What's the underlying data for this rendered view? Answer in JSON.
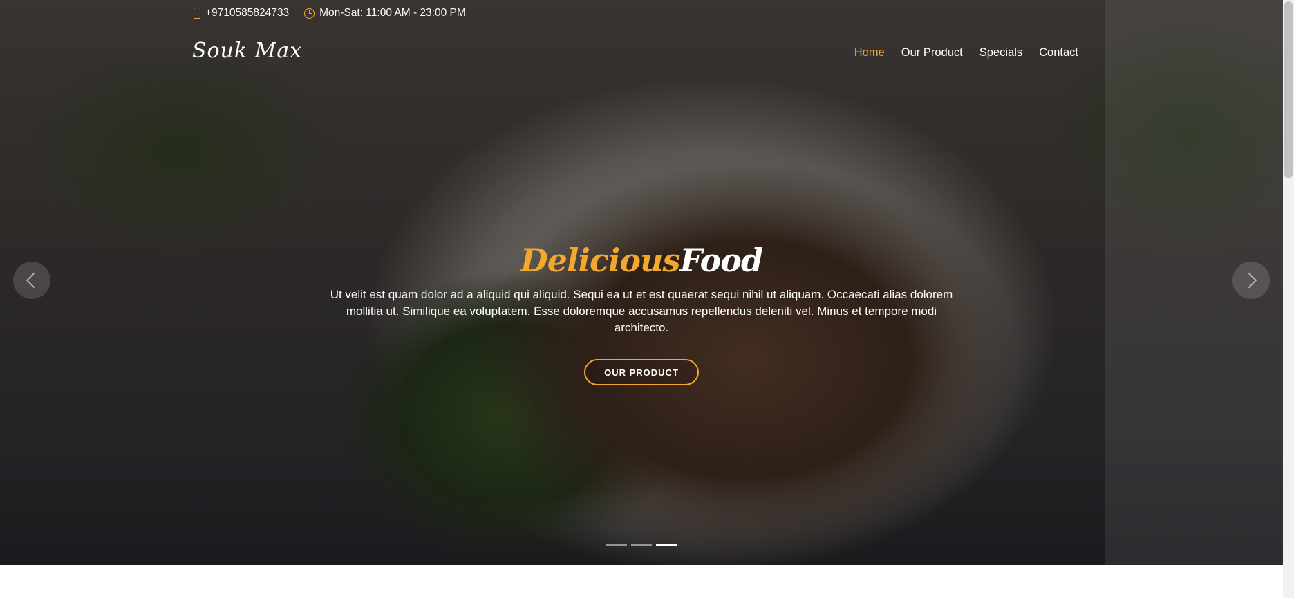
{
  "topbar": {
    "phone": "+9710585824733",
    "hours": "Mon-Sat: 11:00 AM - 23:00 PM"
  },
  "header": {
    "logo": "Souk Max",
    "nav": [
      {
        "label": "Home",
        "active": true
      },
      {
        "label": "Our Product",
        "active": false
      },
      {
        "label": "Specials",
        "active": false
      },
      {
        "label": "Contact",
        "active": false
      }
    ]
  },
  "hero": {
    "title_accent": "Delicious",
    "title_plain": "Food",
    "text": "Ut velit est quam dolor ad a aliquid qui aliquid. Sequi ea ut et est quaerat sequi nihil ut aliquam. Occaecati alias dolorem mollitia ut. Similique ea voluptatem. Esse doloremque accusamus repellendus deleniti vel. Minus et tempore modi architecto.",
    "button": "OUR PRODUCT",
    "slides": 3,
    "active_slide": 3
  },
  "colors": {
    "accent": "#f3a72e",
    "text": "#ffffff"
  },
  "icons": [
    "phone-icon",
    "clock-icon",
    "chevron-left-icon",
    "chevron-right-icon"
  ]
}
